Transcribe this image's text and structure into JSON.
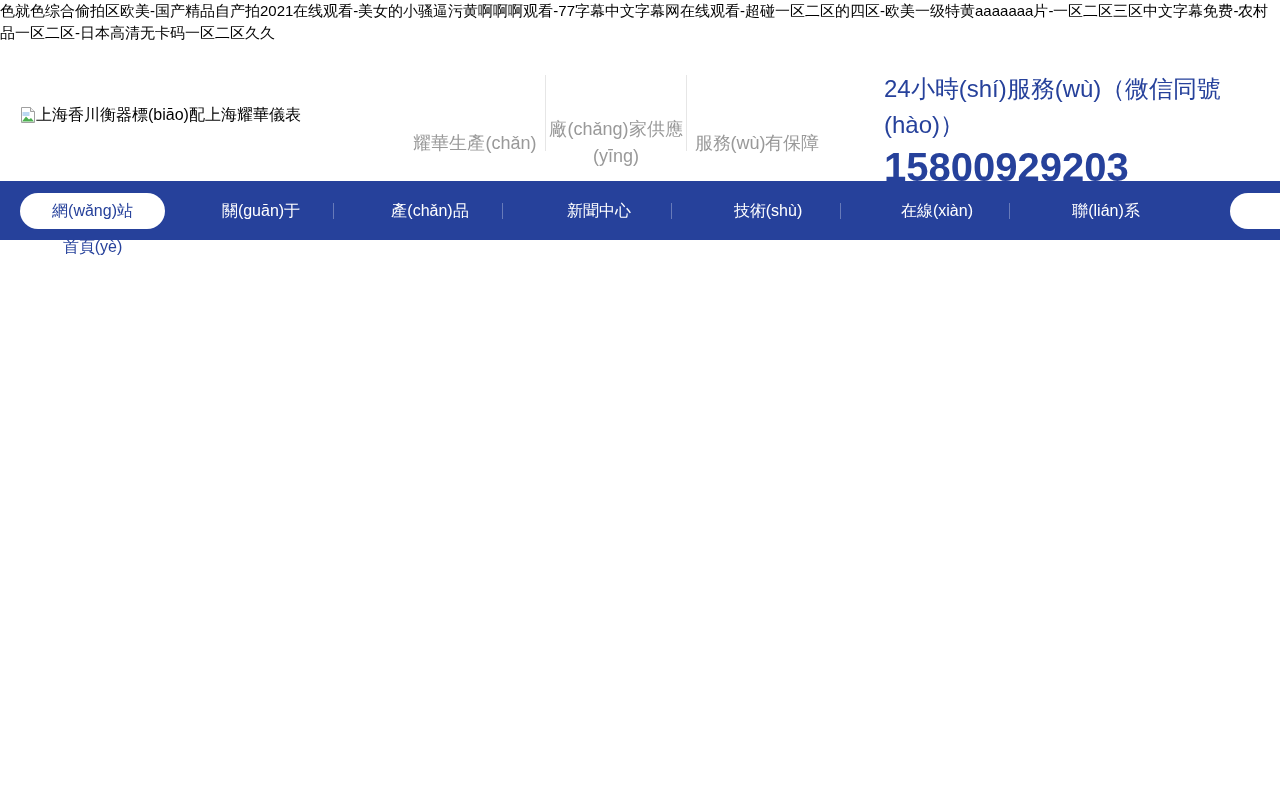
{
  "top_text": {
    "lines": [
      "色就色综合偷拍区欧美-国产精品自产拍2021在线观看-美女的小骚逼污黄啊啊啊观看-77字幕中文字幕网在线观看-超碰一区二区的四区-欧美一级特黄aaaaaaa片-一区二区三区中文字幕免费-农村",
      "品一区二区-日本高清无卡码一区二区久久"
    ]
  },
  "header": {
    "logo_alt": "上海香川衡器標(biāo)配上海耀華儀表",
    "features": [
      "耀華生產(chǎn)",
      "廠(chǎng)家供應(yīng)",
      "服務(wù)有保障"
    ],
    "hotline_label": "24小時(shí)服務(wù)（微信同號(hào)）",
    "hotline_number": "15800929203"
  },
  "nav": {
    "items": [
      {
        "lines": [
          "網(wǎng)站",
          "首頁(yè)"
        ],
        "selected": true
      },
      {
        "lines": [
          "關(guān)于"
        ],
        "selected": false
      },
      {
        "lines": [
          "產(chǎn)品"
        ],
        "selected": false
      },
      {
        "lines": [
          "新聞中心"
        ],
        "selected": false
      },
      {
        "lines": [
          "技術(shù)"
        ],
        "selected": false
      },
      {
        "lines": [
          "在線(xiàn)"
        ],
        "selected": false
      },
      {
        "lines": [
          "聯(lián)系"
        ],
        "selected": false
      }
    ],
    "end_button_visible": true
  }
}
